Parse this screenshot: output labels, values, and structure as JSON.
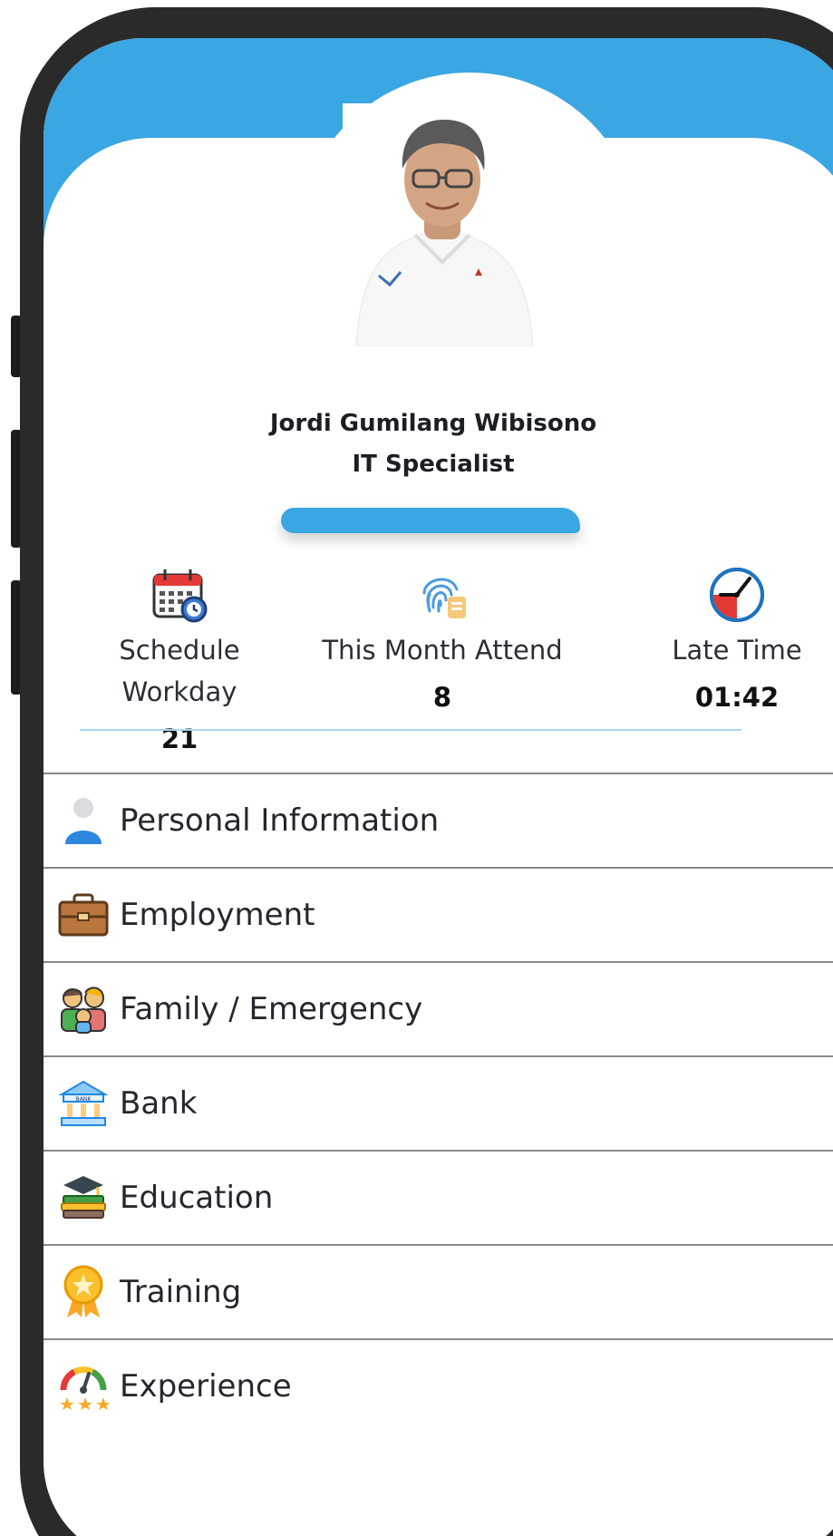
{
  "profile": {
    "name": "Jordi Gumilang Wibisono",
    "role": "IT Specialist",
    "photo_alt": "profile-photo"
  },
  "stats": {
    "schedule": {
      "label": "Schedule Workday",
      "value": "21"
    },
    "attend": {
      "label": "This Month Attend",
      "value": "8"
    },
    "late": {
      "label": "Late Time",
      "value": "01:42"
    }
  },
  "menu": [
    {
      "label": "Personal Information",
      "icon": "user-icon"
    },
    {
      "label": "Employment",
      "icon": "briefcase-icon"
    },
    {
      "label": "Family / Emergency",
      "icon": "family-icon"
    },
    {
      "label": "Bank",
      "icon": "bank-icon"
    },
    {
      "label": "Education",
      "icon": "graduation-icon"
    },
    {
      "label": "Training",
      "icon": "medal-icon"
    },
    {
      "label": "Experience",
      "icon": "gauge-icon"
    }
  ],
  "colors": {
    "primary": "#3aa6e2",
    "divider": "#a9d4f2",
    "late_red": "#e53935"
  }
}
